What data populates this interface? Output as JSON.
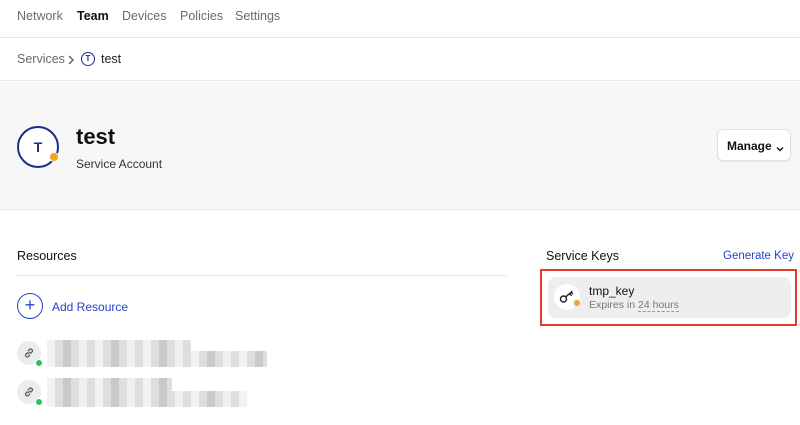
{
  "nav": {
    "items": [
      {
        "label": "Network",
        "active": false
      },
      {
        "label": "Team",
        "active": true
      },
      {
        "label": "Devices",
        "active": false
      },
      {
        "label": "Policies",
        "active": false
      },
      {
        "label": "Settings",
        "active": false
      }
    ]
  },
  "breadcrumb": {
    "parent": "Services",
    "badge": "T",
    "current": "test"
  },
  "account": {
    "avatar_letter": "T",
    "name": "test",
    "type": "Service Account",
    "status_color": "#f0a81d"
  },
  "manage_button": {
    "label": "Manage",
    "icon": "chevron-down-icon"
  },
  "resources": {
    "title": "Resources",
    "add_label": "Add Resource",
    "items": [
      {
        "icon": "link-icon",
        "status": "online",
        "status_color": "#27c25f"
      },
      {
        "icon": "link-icon",
        "status": "online",
        "status_color": "#27c25f"
      }
    ]
  },
  "service_keys": {
    "title": "Service Keys",
    "generate_label": "Generate Key",
    "keys": [
      {
        "name": "tmp_key",
        "expires_prefix": "Expires in ",
        "expires_value": "24 hours",
        "icon": "key-icon",
        "status_color": "#f0a81d"
      }
    ]
  },
  "colors": {
    "brand": "#1d2e8a",
    "accent": "#2543c9",
    "highlight": "#e8392c"
  }
}
